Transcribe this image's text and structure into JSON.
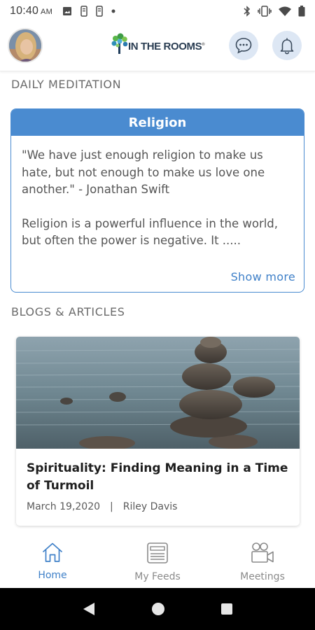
{
  "status_bar": {
    "time": "10:40",
    "ampm": "AM"
  },
  "header": {
    "logo_text": "IN THE ROOMS",
    "logo_mark": "®"
  },
  "daily_meditation": {
    "section_title": "DAILY MEDITATION",
    "title": "Religion",
    "quote": "\"We have just enough religion to make us hate, but not enough to make us love one another.\" - Jonathan Swift",
    "excerpt": "Religion is a powerful influence in the world, but often the power is negative. It .....",
    "show_more": "Show more"
  },
  "blogs": {
    "section_title": "BLOGS & ARTICLES",
    "articles": [
      {
        "title": "Spirituality: Finding Meaning in a Time of Turmoil",
        "date": "March 19,2020",
        "separator": "|",
        "author": "Riley Davis"
      }
    ]
  },
  "bottom_nav": {
    "items": [
      {
        "label": "Home",
        "icon": "home-icon",
        "active": true
      },
      {
        "label": "My Feeds",
        "icon": "feeds-icon",
        "active": false
      },
      {
        "label": "Meetings",
        "icon": "meetings-icon",
        "active": false
      }
    ]
  },
  "colors": {
    "accent": "#4a8bd0",
    "link": "#3f80c8",
    "header_button_bg": "#dde7f4"
  }
}
